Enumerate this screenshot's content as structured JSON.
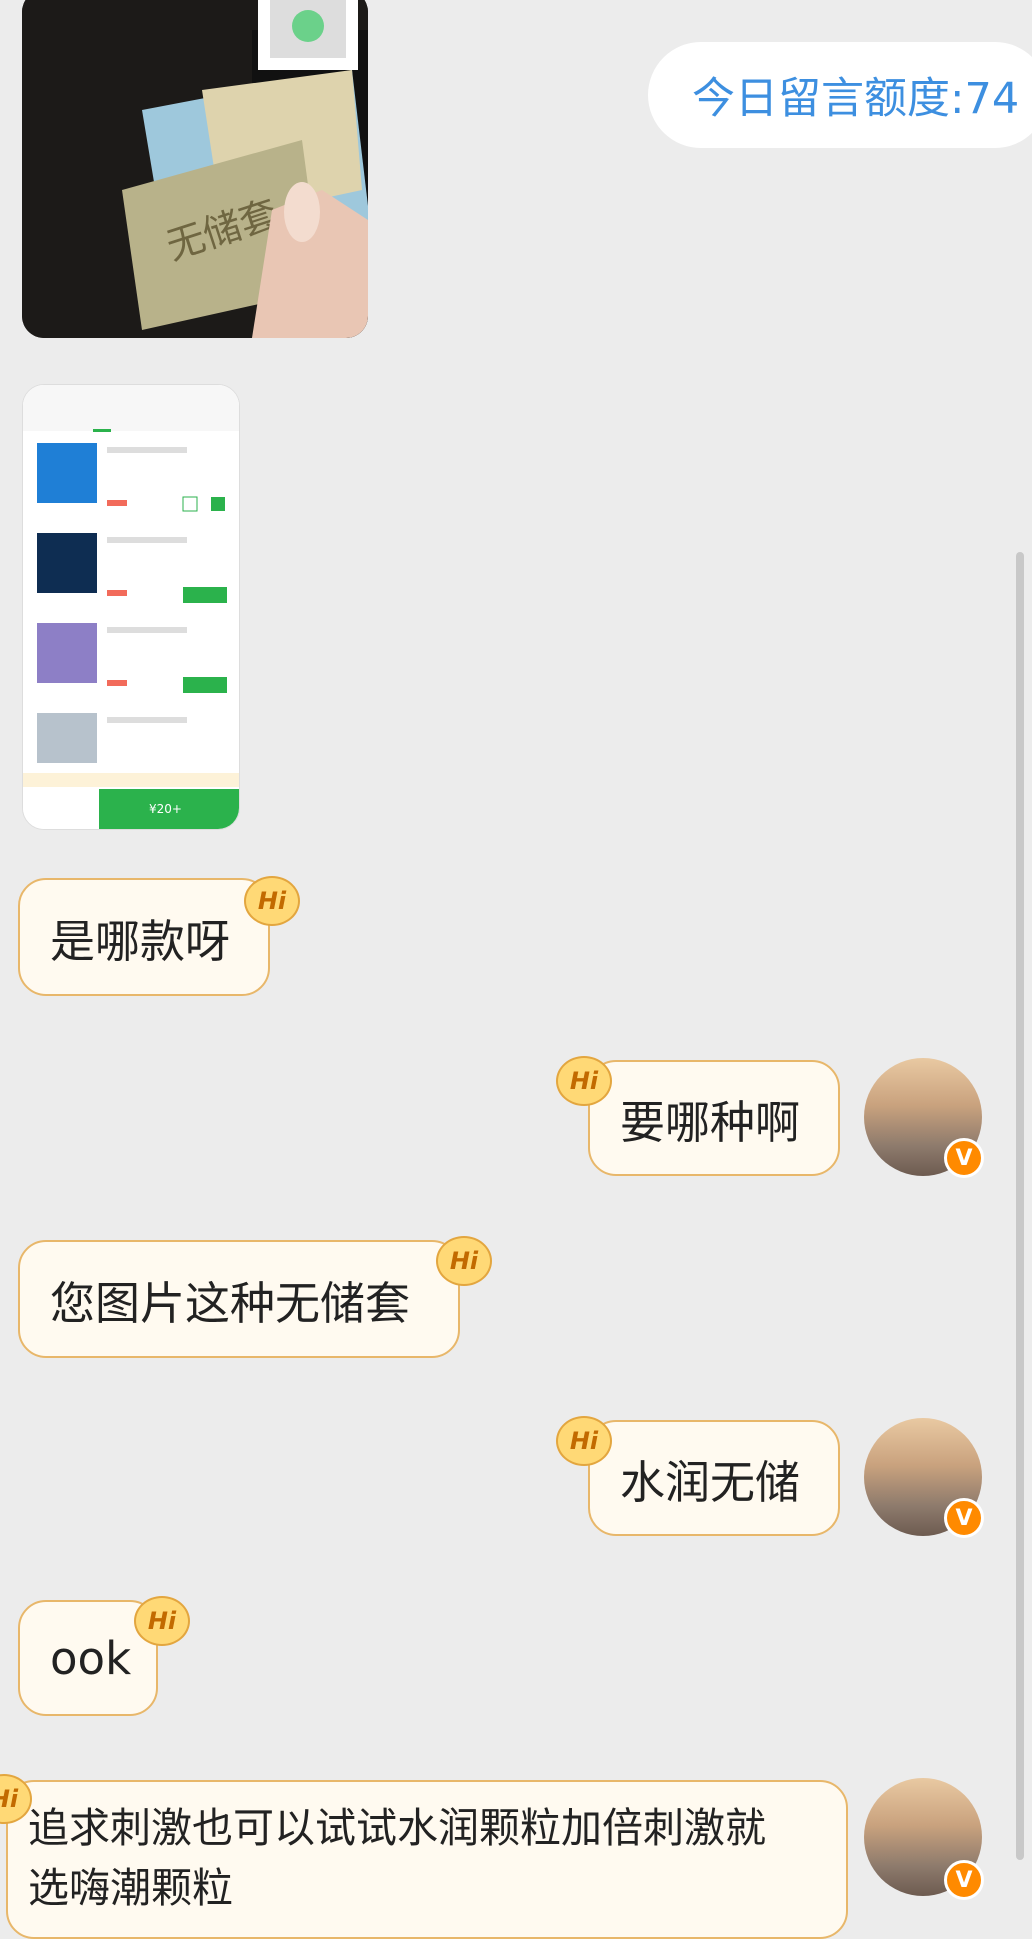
{
  "quota": {
    "label": "今日留言额度:74"
  },
  "images": [
    {
      "name": "photo",
      "stamp_text": "无储套"
    },
    {
      "name": "product-screenshot",
      "price_tag": "¥20+"
    }
  ],
  "messages": [
    {
      "side": "left",
      "text": "是哪款呀",
      "badge": "Hi"
    },
    {
      "side": "right",
      "text": "要哪种啊",
      "badge": "Hi"
    },
    {
      "side": "left",
      "text": "您图片这种无储套",
      "badge": "Hi"
    },
    {
      "side": "right",
      "text": "水润无储",
      "badge": "Hi"
    },
    {
      "side": "left",
      "text": "ook",
      "badge": "Hi"
    },
    {
      "side": "right",
      "text": "追求刺激也可以试试水润颗粒加倍刺激就选嗨潮颗粒",
      "badge": "Hi"
    }
  ],
  "avatar": {
    "verified_badge": "V"
  },
  "colors": {
    "bubble_bg": "#fffaf0",
    "bubble_border": "#e8b76a",
    "quota_text": "#3d8fe0",
    "badge": "#ff8a00"
  }
}
